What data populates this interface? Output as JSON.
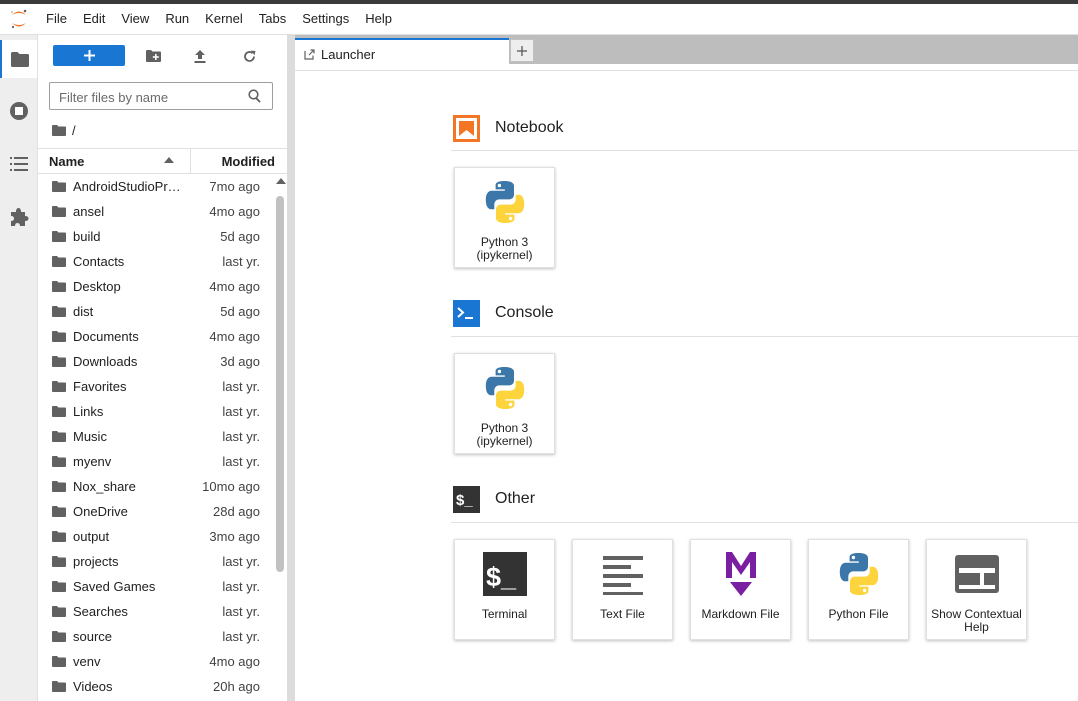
{
  "menubar": {
    "items": [
      "File",
      "Edit",
      "View",
      "Run",
      "Kernel",
      "Tabs",
      "Settings",
      "Help"
    ]
  },
  "filebrowser": {
    "filter_placeholder": "Filter files by name",
    "breadcrumb": "/",
    "columns": {
      "name": "Name",
      "modified": "Modified"
    },
    "files": [
      {
        "name": "AndroidStudioProjects",
        "modified": "7mo ago"
      },
      {
        "name": "ansel",
        "modified": "4mo ago"
      },
      {
        "name": "build",
        "modified": "5d ago"
      },
      {
        "name": "Contacts",
        "modified": "last yr."
      },
      {
        "name": "Desktop",
        "modified": "4mo ago"
      },
      {
        "name": "dist",
        "modified": "5d ago"
      },
      {
        "name": "Documents",
        "modified": "4mo ago"
      },
      {
        "name": "Downloads",
        "modified": "3d ago"
      },
      {
        "name": "Favorites",
        "modified": "last yr."
      },
      {
        "name": "Links",
        "modified": "last yr."
      },
      {
        "name": "Music",
        "modified": "last yr."
      },
      {
        "name": "myenv",
        "modified": "last yr."
      },
      {
        "name": "Nox_share",
        "modified": "10mo ago"
      },
      {
        "name": "OneDrive",
        "modified": "28d ago"
      },
      {
        "name": "output",
        "modified": "3mo ago"
      },
      {
        "name": "projects",
        "modified": "last yr."
      },
      {
        "name": "Saved Games",
        "modified": "last yr."
      },
      {
        "name": "Searches",
        "modified": "last yr."
      },
      {
        "name": "source",
        "modified": "last yr."
      },
      {
        "name": "venv",
        "modified": "4mo ago"
      },
      {
        "name": "Videos",
        "modified": "20h ago"
      }
    ]
  },
  "tabs": [
    {
      "label": "Launcher"
    }
  ],
  "launcher": {
    "notebook": {
      "title": "Notebook",
      "cards": [
        {
          "label": "Python 3 (ipykernel)",
          "icon": "python-icon"
        }
      ]
    },
    "console": {
      "title": "Console",
      "cards": [
        {
          "label": "Python 3 (ipykernel)",
          "icon": "python-icon"
        }
      ]
    },
    "other": {
      "title": "Other",
      "cards": [
        {
          "label": "Terminal",
          "icon": "terminal-icon"
        },
        {
          "label": "Text File",
          "icon": "text-file-icon"
        },
        {
          "label": "Markdown File",
          "icon": "markdown-icon"
        },
        {
          "label": "Python File",
          "icon": "python-icon"
        },
        {
          "label": "Show Contextual Help",
          "icon": "contextual-help-icon"
        }
      ]
    }
  },
  "colors": {
    "accent": "#1976d2",
    "notebook_orange": "#f37626",
    "markdown_purple": "#7b1fa2"
  }
}
